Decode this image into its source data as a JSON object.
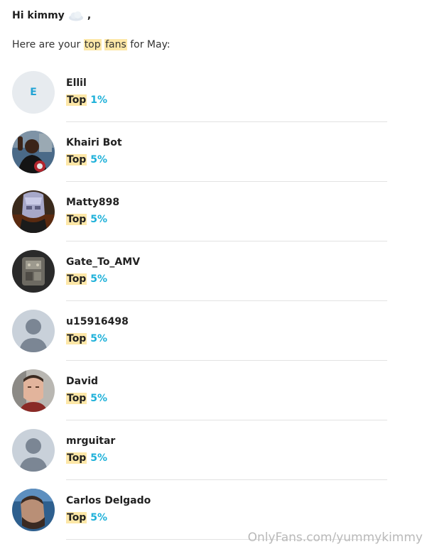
{
  "greeting": {
    "text": "Hi kimmy",
    "punct": ",",
    "icon": "cloud-icon"
  },
  "intro": {
    "pre": "Here are your ",
    "hl1": "top",
    "space": " ",
    "hl2": "fans",
    "post": " for May:"
  },
  "fans": [
    {
      "name": "Ellil",
      "top_label": "Top",
      "percent": "1%",
      "avatar": "letter",
      "letter": "E"
    },
    {
      "name": "Khairi Bot",
      "top_label": "Top",
      "percent": "5%",
      "avatar": "photo"
    },
    {
      "name": "Matty898",
      "top_label": "Top",
      "percent": "5%",
      "avatar": "photo"
    },
    {
      "name": "Gate_To_AMV",
      "top_label": "Top",
      "percent": "5%",
      "avatar": "photo"
    },
    {
      "name": "u15916498",
      "top_label": "Top",
      "percent": "5%",
      "avatar": "default"
    },
    {
      "name": "David",
      "top_label": "Top",
      "percent": "5%",
      "avatar": "photo"
    },
    {
      "name": "mrguitar",
      "top_label": "Top",
      "percent": "5%",
      "avatar": "default"
    },
    {
      "name": "Carlos Delgado",
      "top_label": "Top",
      "percent": "5%",
      "avatar": "photo"
    }
  ],
  "watermark": "OnlyFans.com/yummykimmy",
  "colors": {
    "highlight": "#fde7a7",
    "percent": "#1fb1d9",
    "separator": "#e2e2e2"
  }
}
